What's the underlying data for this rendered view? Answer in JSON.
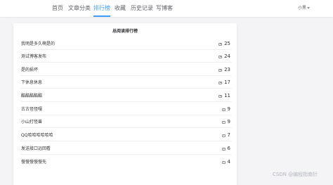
{
  "nav": {
    "items": [
      {
        "label": "首页",
        "active": false
      },
      {
        "label": "文章分类",
        "active": false
      },
      {
        "label": "排行榜",
        "active": true
      },
      {
        "label": "收藏",
        "active": false
      },
      {
        "label": "历史记录",
        "active": false
      },
      {
        "label": "写博客",
        "active": false
      }
    ],
    "user_name": "小黑"
  },
  "ranking": {
    "title": "总阅读排行榜",
    "rows": [
      {
        "title": "我明是多久啊是的",
        "count": "25"
      },
      {
        "title": "测试博客发布",
        "count": "24"
      },
      {
        "title": "是的损坏",
        "count": "23"
      },
      {
        "title": "下休息休息",
        "count": "17"
      },
      {
        "title": "酷酷酷酷酷",
        "count": "11"
      },
      {
        "title": "古古怪怪嘎",
        "count": "9"
      },
      {
        "title": "小山打怪兽",
        "count": "9"
      },
      {
        "title": "QQ哈哈哈哈哈哈",
        "count": "7"
      },
      {
        "title": "发送接口远回看",
        "count": "6"
      },
      {
        "title": "慢慢慢慢慢先",
        "count": "4"
      }
    ]
  },
  "watermark": "CSDN @编程指南针",
  "colors": {
    "accent": "#409eff",
    "text": "#303133",
    "muted": "#909399",
    "background": "#f4f4f6"
  },
  "icons": {
    "view_count": "eye-icon",
    "user_menu": "chevron-down-icon"
  }
}
